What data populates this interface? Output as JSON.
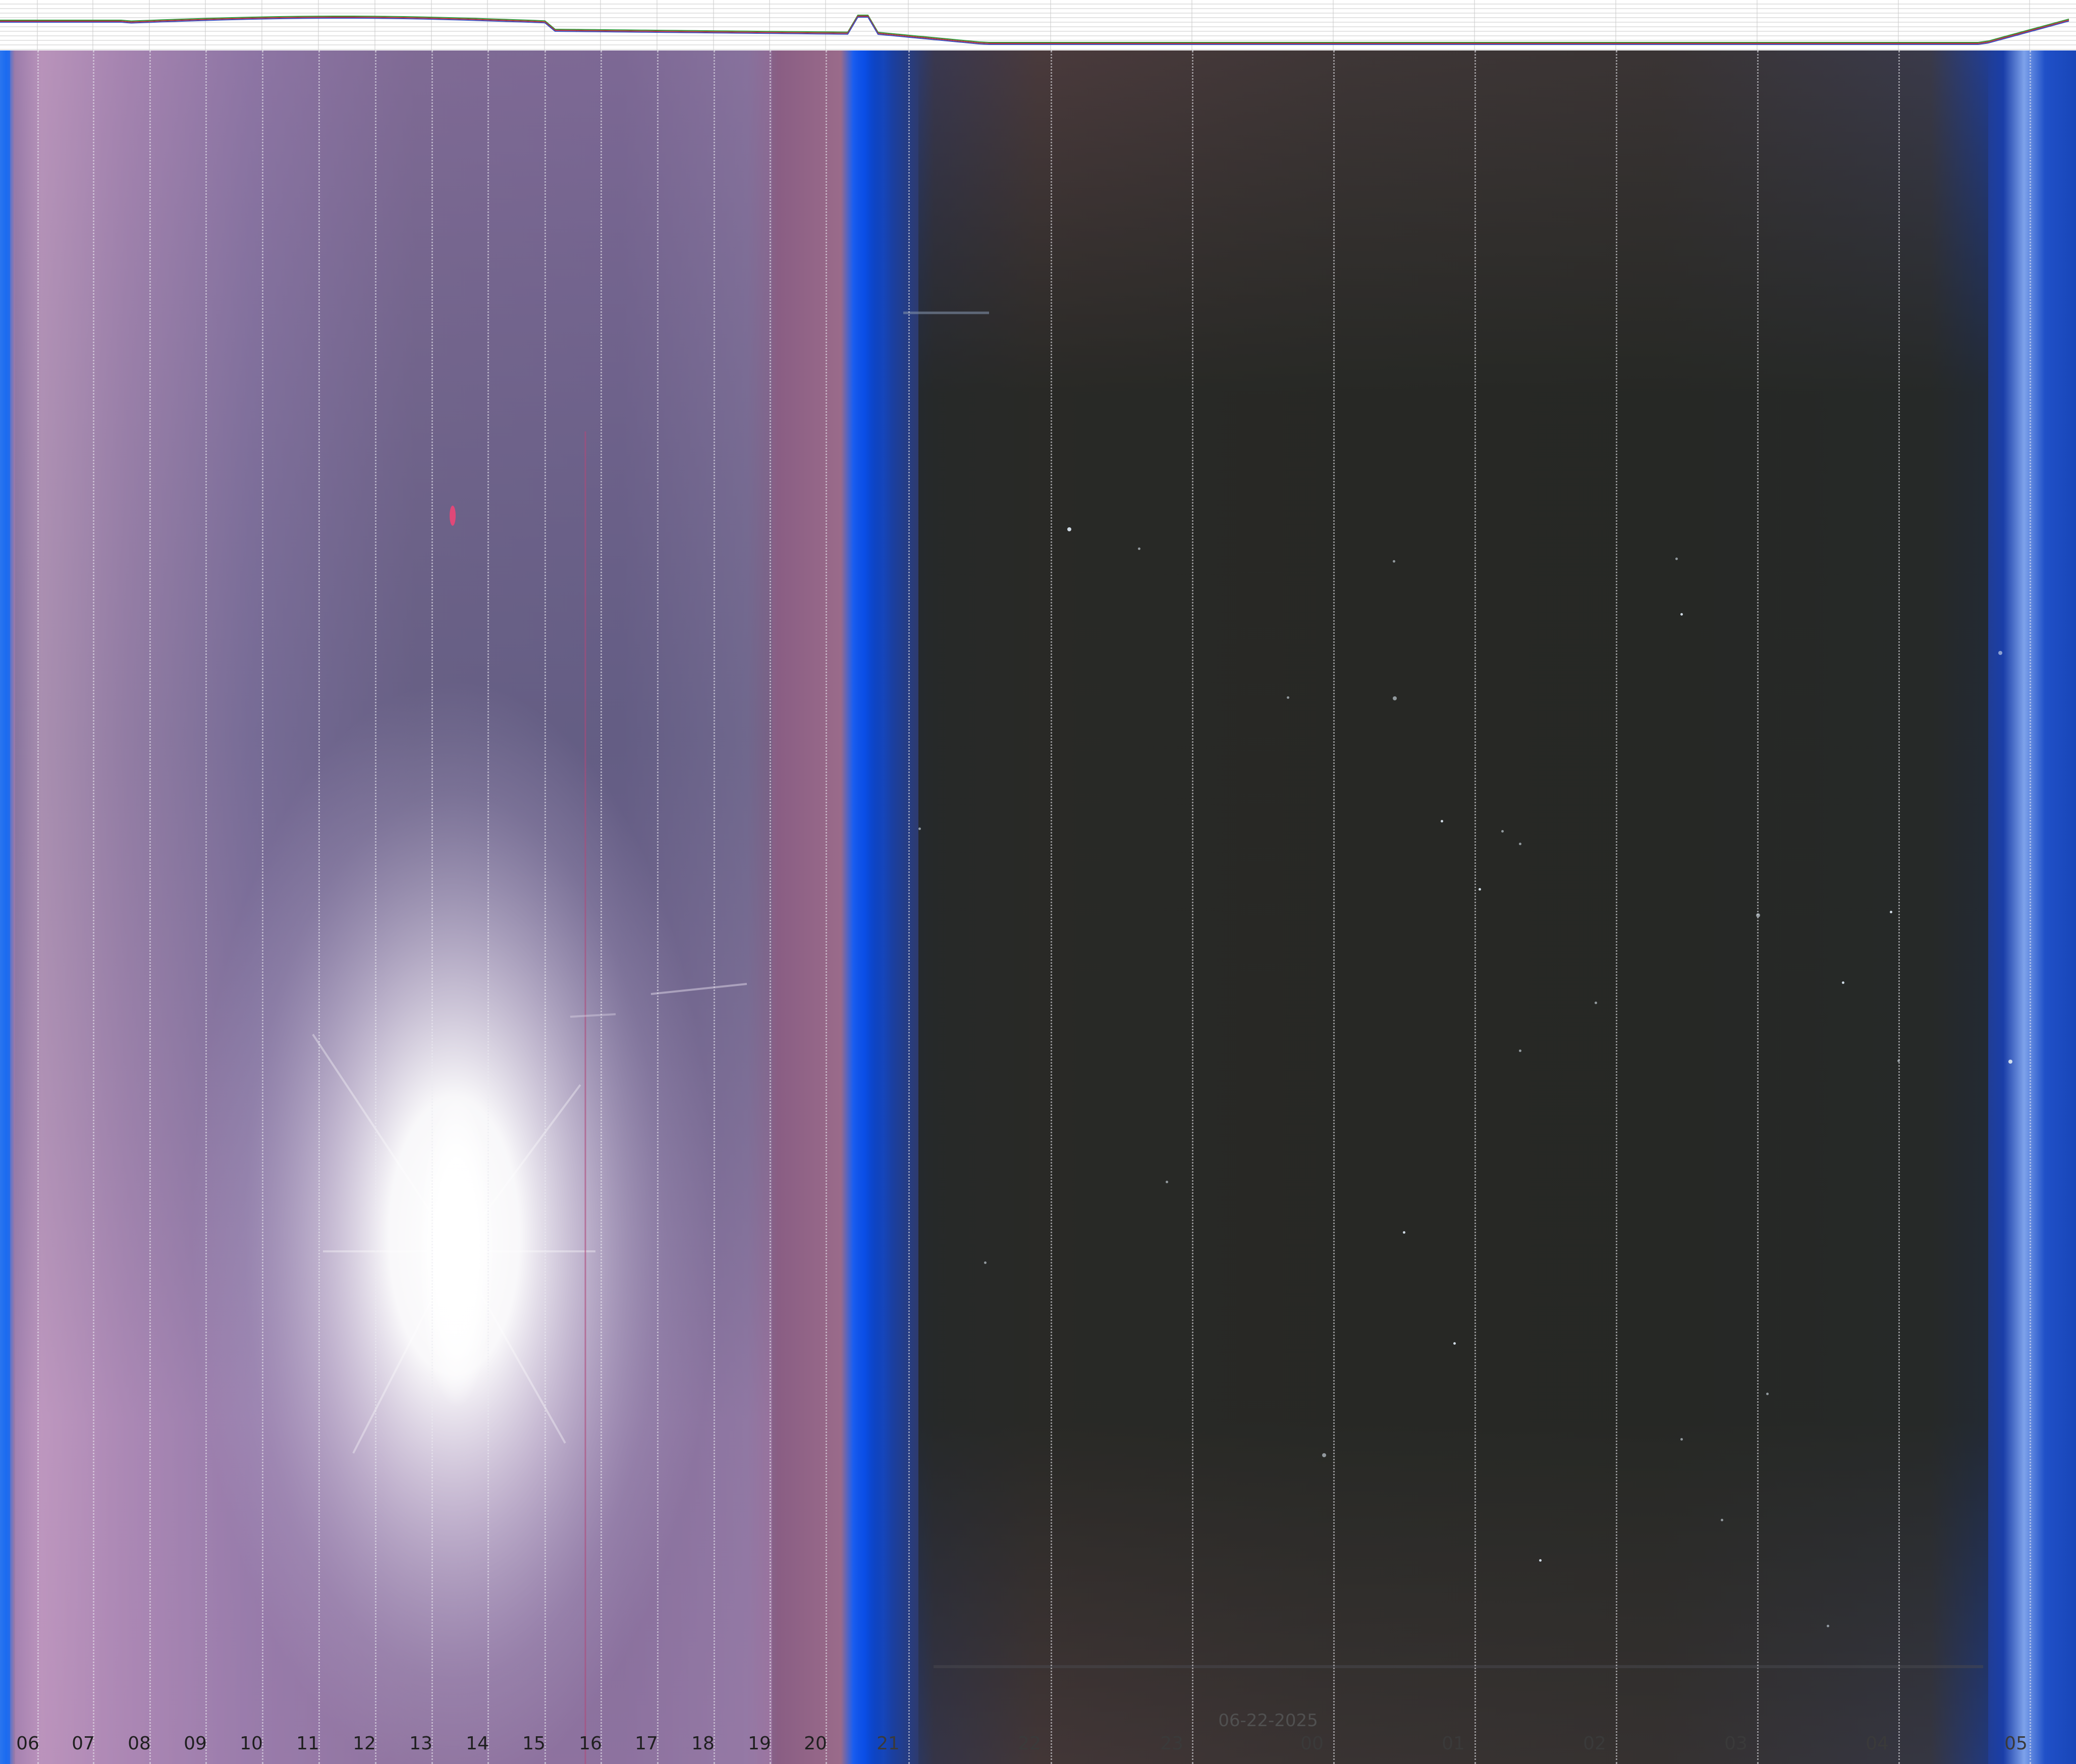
{
  "keogram": {
    "date_label": "06-22-2025",
    "hour_labels": [
      "06",
      "07",
      "08",
      "09",
      "10",
      "11",
      "12",
      "13",
      "14",
      "15",
      "16",
      "17",
      "18",
      "19",
      "20",
      "21",
      "22",
      "23",
      "00",
      "01",
      "02",
      "03",
      "04",
      "05"
    ]
  },
  "colors": {
    "day_sky": "#6e5f86",
    "twilight_blue": "#0a55e8",
    "night_sky": "#232622",
    "sun_glare": "#ffffff",
    "chart_line_green": "#2f9a3a",
    "chart_line_red": "#c0303a",
    "chart_line_blue": "#3a4fc0",
    "chart_grid": "#c8c8c8"
  }
}
